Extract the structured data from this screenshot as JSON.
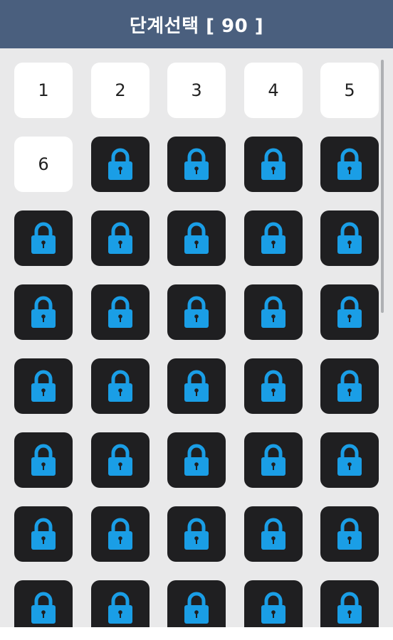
{
  "header": {
    "title": "단계선택 [ 90 ]"
  },
  "stages": {
    "unlocked": [
      "1",
      "2",
      "3",
      "4",
      "5",
      "6"
    ],
    "locked_count_visible": 34,
    "lock_icon": "lock-icon"
  },
  "colors": {
    "header_bg": "#4a5f7e",
    "locked_tile_bg": "#1f1f21",
    "lock_icon": "#1a9ee6",
    "unlocked_tile_bg": "#ffffff",
    "page_bg": "#e9e9ea"
  }
}
